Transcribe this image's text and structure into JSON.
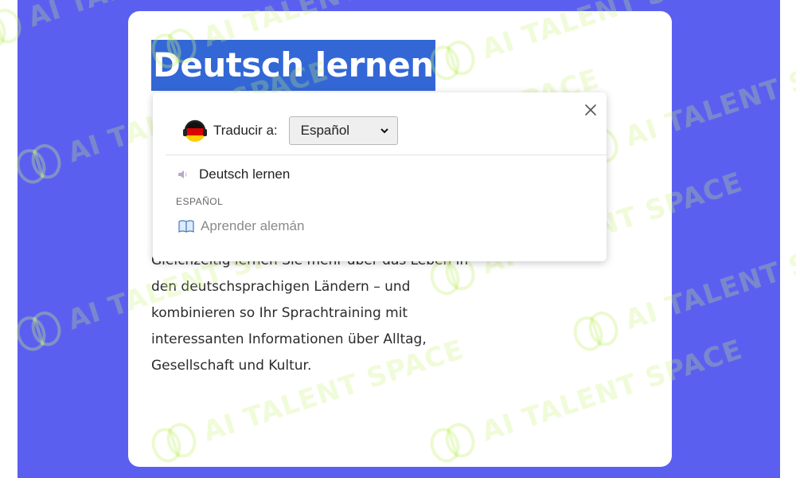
{
  "page": {
    "title": "Deutsch lernen",
    "body_lines": [
      "Gleichzeitig lernen Sie mehr über das Leben in",
      "den deutschsprachigen Ländern – und",
      "kombinieren so Ihr Sprachtraining mit",
      "interessanten Informationen über Alltag,",
      "Gesellschaft und Kultur."
    ]
  },
  "watermark": {
    "text": "AI TALENT SPACE",
    "icon": "brain-icon"
  },
  "popup": {
    "translate_label": "Traducir a:",
    "target_language": "Español",
    "source_text": "Deutsch lernen",
    "target_language_caption": "ESPAÑOL",
    "translation": "Aprender alemán",
    "icons": {
      "flag": "german-flag-headphones-icon",
      "close": "close-icon",
      "speaker": "speaker-icon",
      "dictionary": "book-icon"
    }
  },
  "colors": {
    "background": "#5b5ff0",
    "selection": "#3367d6",
    "watermark": "#c8f078"
  }
}
